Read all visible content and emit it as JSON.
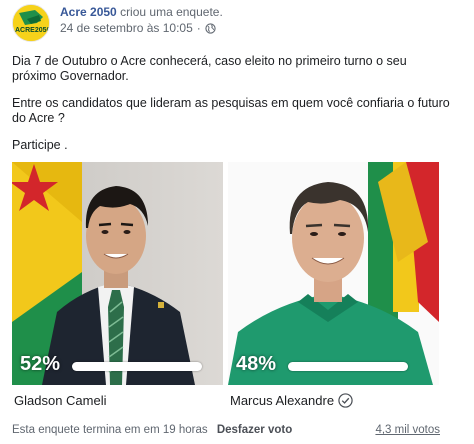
{
  "post": {
    "page_name": "Acre 2050",
    "action": "criou uma enquete.",
    "timestamp": "24 de setembro às 10:05",
    "separator": "·",
    "privacy_icon": "globe-icon",
    "avatar_text": "ACRE2050"
  },
  "body": {
    "paragraph1": "Dia 7 de Outubro o Acre conhecerá, caso eleito no primeiro turno o seu próximo Governador.",
    "paragraph2": "Entre os candidatos que lideram as pesquisas em quem você confiaria o futuro do Acre ?",
    "paragraph3": "Participe ."
  },
  "poll": {
    "options": [
      {
        "name": "Gladson Cameli",
        "percent_label": "52%",
        "percent": 52,
        "voted": false
      },
      {
        "name": "Marcus Alexandre",
        "percent_label": "48%",
        "percent": 48,
        "voted": true
      }
    ],
    "footer_text": "Esta enquete termina em em 19 horas",
    "undo_label": "Desfazer voto",
    "votes_label": "4,3 mil votos"
  },
  "colors": {
    "link": "#385898",
    "secondary": "#606770",
    "acre_green": "#1f8f4a",
    "acre_yellow": "#f2c81b",
    "acre_red": "#d3262b"
  }
}
